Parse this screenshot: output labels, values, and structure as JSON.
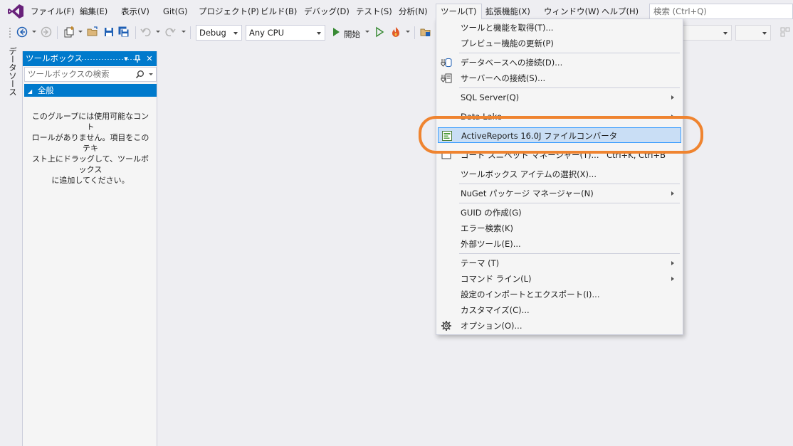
{
  "menubar": {
    "items": [
      {
        "label": "ファイル(F)"
      },
      {
        "label": "編集(E)"
      },
      {
        "label": "表示(V)"
      },
      {
        "label": "Git(G)"
      },
      {
        "label": "プロジェクト(P)"
      },
      {
        "label": "ビルド(B)"
      },
      {
        "label": "デバッグ(D)"
      },
      {
        "label": "テスト(S)"
      },
      {
        "label": "分析(N)"
      },
      {
        "label": "ツール(T)"
      },
      {
        "label": "拡張機能(X)"
      },
      {
        "label": "ウィンドウ(W)"
      },
      {
        "label": "ヘルプ(H)"
      }
    ],
    "search_placeholder": "検索 (Ctrl+Q)"
  },
  "toolbar": {
    "config": "Debug",
    "platform": "Any CPU",
    "start_label": "開始"
  },
  "side_tab": {
    "label": "データソース"
  },
  "toolbox": {
    "title": "ツールボックス",
    "search_placeholder": "ツールボックスの検索",
    "group": "全般",
    "empty_message": "このグループには使用可能なコント\nロールがありません。項目をこのテキ\nスト上にドラッグして、ツールボックス\nに追加してください。"
  },
  "tools_menu": {
    "items": [
      {
        "label": "ツールと機能を取得(T)..."
      },
      {
        "label": "プレビュー機能の更新(P)"
      },
      {
        "label": "データベースへの接続(D)..."
      },
      {
        "label": "サーバーへの接続(S)..."
      },
      {
        "label": "SQL Server(Q)"
      },
      {
        "label": "Data Lake"
      },
      {
        "label": "ActiveReports 16.0J ファイルコンバータ"
      },
      {
        "label": "コード スニペット マネージャー(T)...",
        "shortcut": "Ctrl+K, Ctrl+B"
      },
      {
        "label": "ツールボックス アイテムの選択(X)..."
      },
      {
        "label": "NuGet パッケージ マネージャー(N)"
      },
      {
        "label": "GUID の作成(G)"
      },
      {
        "label": "エラー検索(K)"
      },
      {
        "label": "外部ツール(E)..."
      },
      {
        "label": "テーマ (T)"
      },
      {
        "label": "コマンド ライン(L)"
      },
      {
        "label": "設定のインポートとエクスポート(I)..."
      },
      {
        "label": "カスタマイズ(C)..."
      },
      {
        "label": "オプション(O)..."
      }
    ]
  },
  "colors": {
    "accent": "#007acc",
    "highlight": "#c9def5",
    "annotation": "#ef8430",
    "vs_purple": "#68217a"
  }
}
